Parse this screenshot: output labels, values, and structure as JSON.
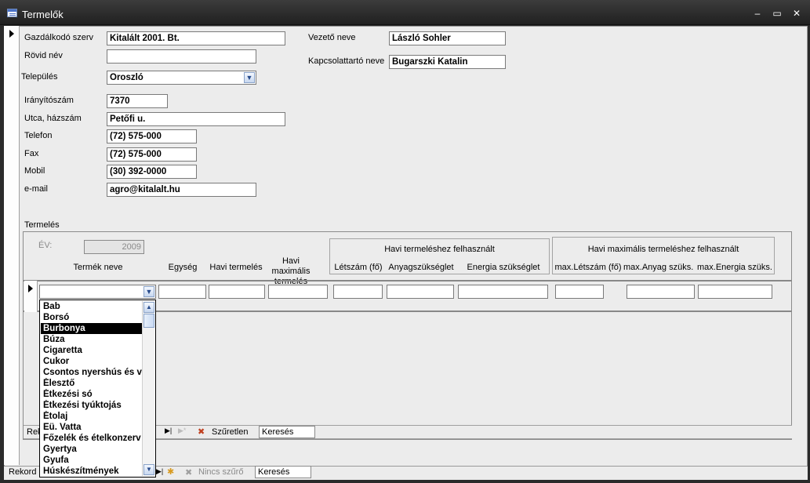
{
  "window": {
    "title": "Termelők",
    "minimize": "–",
    "restore": "▭",
    "close": "✕"
  },
  "form": {
    "gazdalkodo_label": "Gazdálkodó szerv",
    "gazdalkodo_value": "Kitalált 2001. Bt.",
    "rovid_label": "Rövid név",
    "rovid_value": "",
    "telepules_label": "Település",
    "telepules_value": "Oroszló",
    "irsz_label": "Irányítószám",
    "irsz_value": "7370",
    "utca_label": "Utca, házszám",
    "utca_value": "Petőfi u.",
    "telefon_label": "Telefon",
    "telefon_value": "(72) 575-000",
    "fax_label": "Fax",
    "fax_value": "(72) 575-000",
    "mobil_label": "Mobil",
    "mobil_value": "(30) 392-0000",
    "email_label": "e-mail",
    "email_value": "agro@kitalalt.hu",
    "vezeto_label": "Vezető neve",
    "vezeto_value": "László Sohler",
    "kapcsolat_label": "Kapcsolattartó neve",
    "kapcsolat_value": "Bugarszki Katalin"
  },
  "termeles": {
    "section_label": "Termelés",
    "ev_label": "ÉV:",
    "ev_value": "2009",
    "col_termek": "Termék neve",
    "col_egyseg": "Egység",
    "col_havi": "Havi termelés",
    "col_havimax": "Havi maximális termelés",
    "grp1_title": "Havi termeléshez felhasznált",
    "col_letszam": "Létszám (fő)",
    "col_anyag": "Anyagszükséglet",
    "col_energia": "Energia szükséglet",
    "grp2_title": "Havi maximális termeléshez felhasznált",
    "col_maxletszam": "max.Létszám (fő)",
    "col_maxanyag": "max.Anyag szüks.",
    "col_maxenergia": "max.Energia szüks."
  },
  "subnav": {
    "record_label": "Reko",
    "filter_label": "Szűretlen",
    "search_placeholder": "Keresés"
  },
  "mainnav": {
    "record_label": "Rekord",
    "filter_label": "Nincs szűrő",
    "search_placeholder": "Keresés"
  },
  "dropdown": {
    "items": [
      "Bab",
      "Borsó",
      "Burbonya",
      "Búza",
      "Cigaretta",
      "Cukor",
      "Csontos nyershús és v",
      "Élesztő",
      "Étkezési só",
      "Étkezési tyúktojás",
      "Étolaj",
      "Eü. Vatta",
      "Főzelék és ételkonzerv",
      "Gyertya",
      "Gyufa",
      "Húskészítmények"
    ],
    "selected_index": 2
  }
}
